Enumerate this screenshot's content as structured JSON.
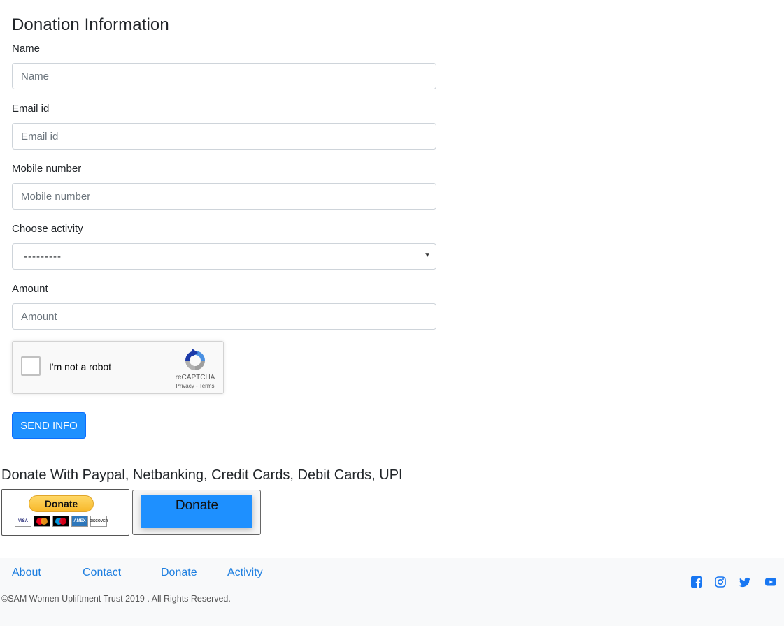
{
  "form": {
    "title": "Donation Information",
    "name_label": "Name",
    "name_placeholder": "Name",
    "email_label": "Email id",
    "email_placeholder": "Email id",
    "mobile_label": "Mobile number",
    "mobile_placeholder": "Mobile number",
    "activity_label": "Choose activity",
    "activity_selected": "---------",
    "amount_label": "Amount",
    "amount_placeholder": "Amount",
    "submit_label": "SEND INFO"
  },
  "recaptcha": {
    "label": "I'm not a robot",
    "brand": "reCAPTCHA",
    "links": "Privacy - Terms"
  },
  "donate": {
    "heading": "Donate With Paypal, Netbanking, Credit Cards, Debit Cards, UPI",
    "paypal_label": "Donate",
    "card_visa": "VISA",
    "card_amex": "AMEX",
    "card_discover": "DISCOVER",
    "gateway_label": "Donate"
  },
  "footer": {
    "links": [
      "About",
      "Contact",
      "Donate",
      "Activity"
    ],
    "copyright": "©SAM Women Upliftment Trust 2019 . All Rights Reserved."
  },
  "colors": {
    "primary": "#1e90ff",
    "link": "#1e7fe0",
    "footer_bg": "#f8f9fa"
  },
  "icons": [
    "chevron-down-icon",
    "recaptcha-logo-icon",
    "facebook-icon",
    "instagram-icon",
    "twitter-icon",
    "youtube-icon"
  ]
}
